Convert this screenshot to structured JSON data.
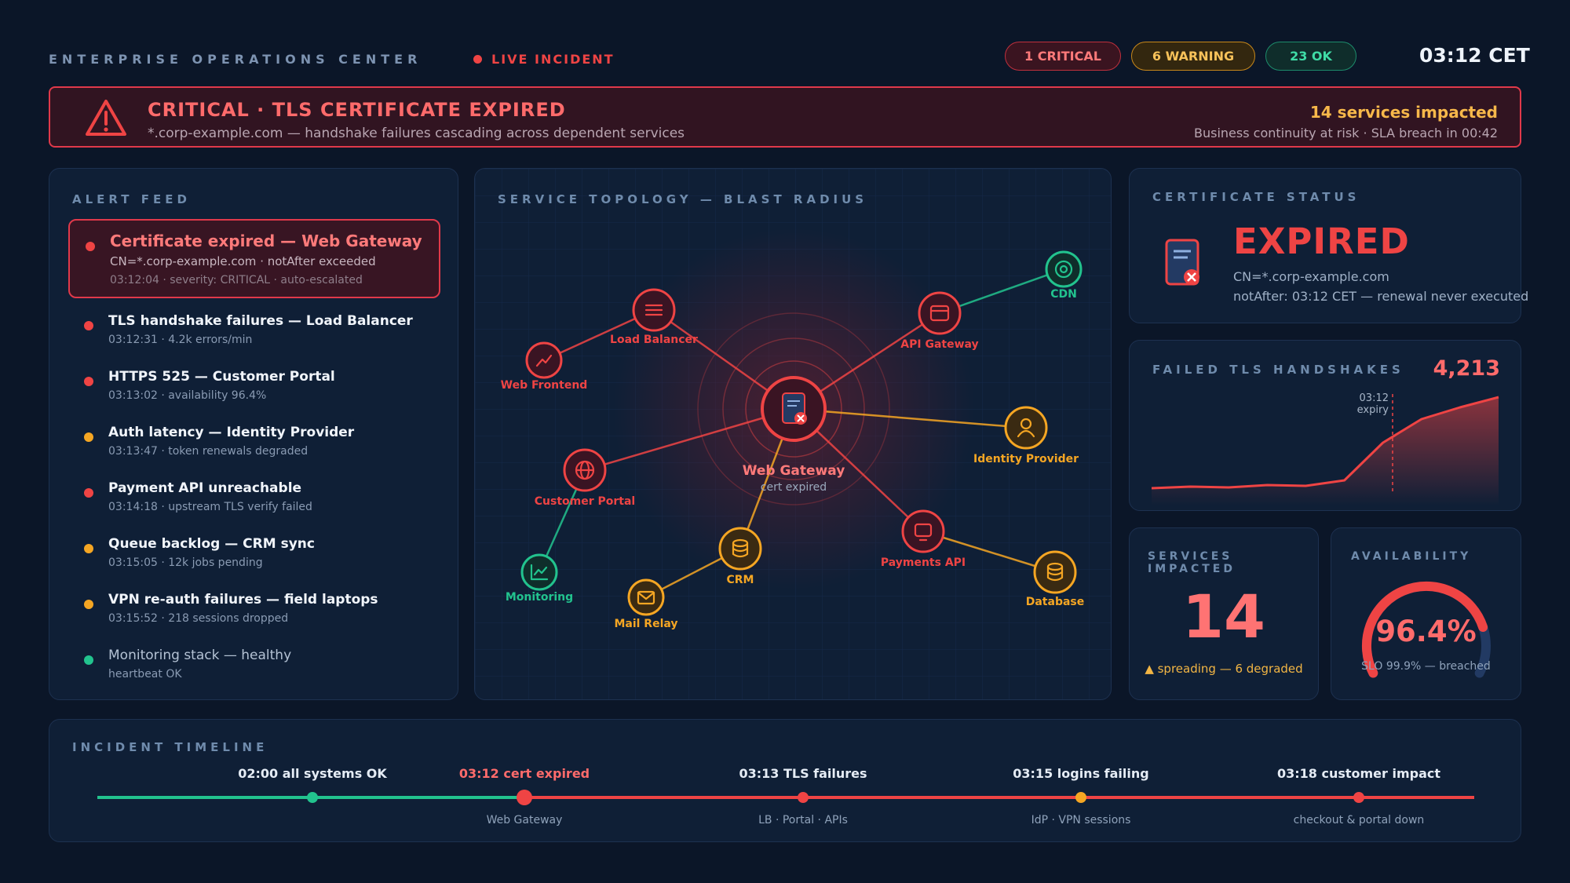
{
  "header": {
    "title": "ENTERPRISE OPERATIONS CENTER",
    "live_label": "LIVE INCIDENT",
    "pills": {
      "critical": "1 CRITICAL",
      "warning": "6 WARNING",
      "ok": "23 OK"
    },
    "clock": "03:12 CET"
  },
  "banner": {
    "title": "CRITICAL · TLS CERTIFICATE EXPIRED",
    "subtitle": "*.corp-example.com — handshake failures cascading across dependent services",
    "impact": "14 services impacted",
    "sla": "Business continuity at risk · SLA breach in 00:42"
  },
  "alert_feed": {
    "title": "ALERT FEED",
    "items": [
      {
        "title": "Certificate expired — Web Gateway",
        "sub": "CN=*.corp-example.com · notAfter exceeded",
        "meta": "03:12:04 · severity: CRITICAL · auto-escalated",
        "color": "#ef4444"
      },
      {
        "title": "TLS handshake failures — Load Balancer",
        "sub": "03:12:31 · 4.2k errors/min",
        "color": "#ef4444"
      },
      {
        "title": "HTTPS 525 — Customer Portal",
        "sub": "03:13:02 · availability 96.4%",
        "color": "#ef4444"
      },
      {
        "title": "Auth latency — Identity Provider",
        "sub": "03:13:47 · token renewals degraded",
        "color": "#f5a623"
      },
      {
        "title": "Payment API unreachable",
        "sub": "03:14:18 · upstream TLS verify failed",
        "color": "#ef4444"
      },
      {
        "title": "Queue backlog — CRM sync",
        "sub": "03:15:05 · 12k jobs pending",
        "color": "#f5a623"
      },
      {
        "title": "VPN re-auth failures — field laptops",
        "sub": "03:15:52 · 218 sessions dropped",
        "color": "#f5a623"
      },
      {
        "title": "Monitoring stack — healthy",
        "sub": "heartbeat OK",
        "color": "#22c38e"
      }
    ]
  },
  "topology": {
    "title": "SERVICE TOPOLOGY — BLAST RADIUS",
    "center": {
      "label": "Web Gateway",
      "sub": "cert expired"
    },
    "nodes": [
      {
        "id": "lb",
        "label": "Load Balancer",
        "status": "critical",
        "icon": "list-icon"
      },
      {
        "id": "wf",
        "label": "Web Frontend",
        "status": "critical",
        "icon": "trend-icon"
      },
      {
        "id": "api",
        "label": "API Gateway",
        "status": "critical",
        "icon": "window-icon"
      },
      {
        "id": "cdn",
        "label": "CDN",
        "status": "ok",
        "icon": "target-icon"
      },
      {
        "id": "idp",
        "label": "Identity Provider",
        "status": "warning",
        "icon": "user-icon"
      },
      {
        "id": "cp",
        "label": "Customer Portal",
        "status": "critical",
        "icon": "globe-icon"
      },
      {
        "id": "crm",
        "label": "CRM",
        "status": "warning",
        "icon": "database-icon"
      },
      {
        "id": "pay",
        "label": "Payments API",
        "status": "critical",
        "icon": "monitor-icon"
      },
      {
        "id": "db",
        "label": "Database",
        "status": "warning",
        "icon": "database-icon"
      },
      {
        "id": "mon",
        "label": "Monitoring",
        "status": "ok",
        "icon": "chart-icon"
      },
      {
        "id": "mail",
        "label": "Mail Relay",
        "status": "warning",
        "icon": "mail-icon"
      }
    ]
  },
  "certificate": {
    "title": "CERTIFICATE STATUS",
    "status": "EXPIRED",
    "cn": "CN=*.corp-example.com",
    "not_after": "notAfter: 03:12 CET — renewal never executed"
  },
  "tls": {
    "title": "FAILED TLS HANDSHAKES",
    "count": "4,213",
    "marker_label": "03:12 expiry",
    "series": [
      2,
      4,
      3,
      6,
      5,
      12,
      60,
      90,
      105,
      118
    ]
  },
  "services": {
    "title": "SERVICES IMPACTED",
    "value": "14",
    "note": "▲ spreading — 6 degraded"
  },
  "availability": {
    "title": "AVAILABILITY",
    "value": "96.4%",
    "fraction": 0.964,
    "slo": "SLO 99.9% — breached"
  },
  "timeline": {
    "title": "INCIDENT TIMELINE",
    "events": [
      {
        "label": "02:00 all systems OK",
        "sub": "",
        "color": "#22c38e"
      },
      {
        "label": "03:12 cert expired",
        "sub": "Web Gateway",
        "color": "#ef4444"
      },
      {
        "label": "03:13 TLS failures",
        "sub": "LB · Portal · APIs",
        "color": "#ef4444"
      },
      {
        "label": "03:15 logins failing",
        "sub": "IdP · VPN sessions",
        "color": "#f5a623"
      },
      {
        "label": "03:18 customer impact",
        "sub": "checkout & portal down",
        "color": "#ef4444"
      }
    ]
  },
  "colors": {
    "critical": "#ef4444",
    "warning": "#f5a623",
    "ok": "#22c38e",
    "background": "#0b1628",
    "panel": "#0f1f36"
  }
}
